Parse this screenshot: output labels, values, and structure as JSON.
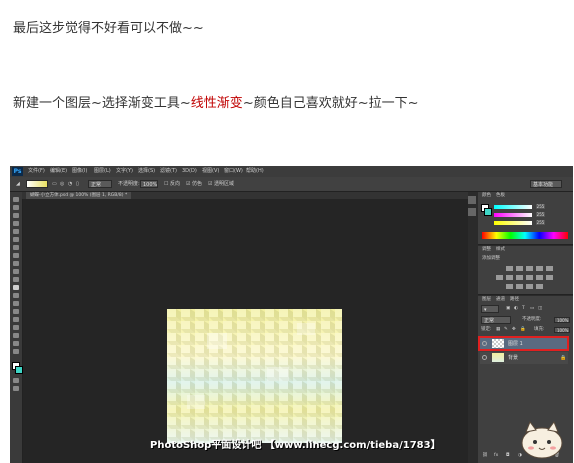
{
  "article": {
    "line1": "最后这步觉得不好看可以不做~~",
    "line2_before": "新建一个图层~选择渐变工具~",
    "line2_highlight": "线性渐变",
    "line2_after": "~颜色自己喜欢就好~拉一下~"
  },
  "app": {
    "logo": "Ps",
    "menus": [
      "文件(F)",
      "编辑(E)",
      "图像(I)",
      "图层(L)",
      "文字(Y)",
      "选择(S)",
      "滤镜(T)",
      "3D(D)",
      "视图(V)",
      "窗口(W)",
      "帮助(H)"
    ],
    "options": {
      "mode_value": "正常",
      "opacity_label": "不透明度:",
      "opacity_value": "100%",
      "reverse_label": "反向",
      "dither_label": "仿色",
      "transparency_label": "透明区域",
      "workspace": "基本功能"
    },
    "document_tab": "蝴蝶-小立方体.psd @ 100% (图层 1, RGB/8) *",
    "color_panel": {
      "tabs": [
        "颜色",
        "色板"
      ],
      "r_value": "255",
      "g_value": "255",
      "b_value": "255"
    },
    "adjust_panel": {
      "tabs": [
        "调整",
        "样式"
      ],
      "title": "添加调整"
    },
    "layers_panel": {
      "tabs": [
        "图层",
        "通道",
        "路径"
      ],
      "blend_mode": "正常",
      "opacity_label": "不透明度:",
      "opacity_value": "100%",
      "lock_label": "锁定:",
      "fill_label": "填充:",
      "fill_value": "100%",
      "layers": [
        {
          "name": "图层 1",
          "selected": true
        },
        {
          "name": "背景",
          "selected": false
        }
      ]
    },
    "highlight_color": "#e02020"
  },
  "watermark": "PhotoShop平面设计吧 【www.linecg.com/tieba/1783】"
}
